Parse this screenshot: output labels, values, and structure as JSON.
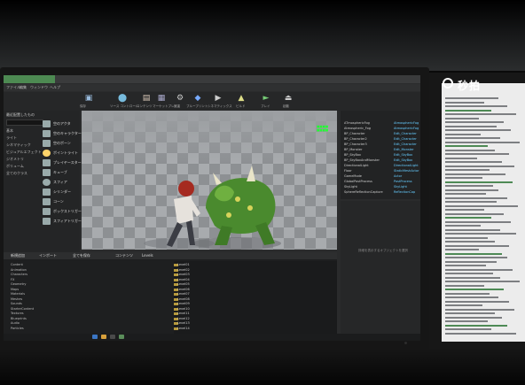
{
  "left_monitor": {
    "titlebar_text": "",
    "menu": [
      "ファイル",
      "編集",
      "ウィンドウ",
      "ヘルプ"
    ],
    "toolbar": [
      {
        "icon": "save-icon",
        "label": "保存"
      },
      {
        "icon": "source-control-icon",
        "label": "ソース コントロール"
      },
      {
        "icon": "content-icon",
        "label": "コンテンツ"
      },
      {
        "icon": "marketplace-icon",
        "label": "マーケットプレイス"
      },
      {
        "icon": "settings-icon",
        "label": "設定"
      },
      {
        "icon": "blueprints-icon",
        "label": "ブループリント"
      },
      {
        "icon": "cinematics-icon",
        "label": "シネマティックス"
      },
      {
        "icon": "build-icon",
        "label": "ビルド"
      },
      {
        "icon": "play-icon",
        "label": "プレイ"
      },
      {
        "icon": "launch-icon",
        "label": "起動"
      }
    ],
    "modes_panel": {
      "title": "最近配置したもの",
      "categories": [
        "基本",
        "ライト",
        "シネマティック",
        "ビジュアルエフェクト",
        "ジオメトリ",
        "ボリューム",
        "全てのクラス"
      ],
      "assets": [
        "空のアクタ",
        "空のキャラクター",
        "空のポーン",
        "ポイントライト",
        "プレイヤースタート",
        "キューブ",
        "スフィア",
        "シリンダー",
        "コーン",
        "ボックストリガー",
        "スフィアトリガー"
      ]
    },
    "outliner": {
      "rows": [
        {
          "label": "ATmosphericFog",
          "type": "AtmosphericFog"
        },
        {
          "label": "Atmospheric_Fog",
          "type": "AtmosphericFog"
        },
        {
          "label": "BP_Character",
          "type": "Edit_Character"
        },
        {
          "label": "BP_Character2",
          "type": "Edit_Character"
        },
        {
          "label": "BP_Character3",
          "type": "Edit_Character"
        },
        {
          "label": "BP_Monster",
          "type": "Edit_Monster"
        },
        {
          "label": "BP_SkyBox",
          "type": "Edit_SkyBox"
        },
        {
          "label": "BP_SkyBoxAndMonster",
          "type": "Edit_SkyBox"
        },
        {
          "label": "DirectionalLight",
          "type": "DirectionalLight"
        },
        {
          "label": "Floor",
          "type": "StaticMeshActor"
        },
        {
          "label": "GameMode",
          "type": "Actor"
        },
        {
          "label": "GlobalPostProcess",
          "type": "PostProcess"
        },
        {
          "label": "SkyLight",
          "type": "SkyLight"
        },
        {
          "label": "SphereReflectionCapture",
          "type": "ReflectionCap"
        }
      ]
    },
    "details_text": "詳細を表示するオブジェクトを選択",
    "content_browser": {
      "buttons": [
        "新規追加",
        "インポート",
        "全てを保存",
        "コンテンツ",
        "Levels"
      ],
      "tree": [
        "Content",
        "Animation",
        "Characters",
        "FX",
        "Geometry",
        "Maps",
        "Materials",
        "Meshes",
        "Sounds",
        "StarterContent",
        "Textures",
        "Blueprints",
        "Audio",
        "Particles"
      ],
      "items": [
        "Level01",
        "Level02",
        "Level03",
        "Level04",
        "Level05",
        "Level06",
        "Level07",
        "Level08",
        "Level09",
        "Level10",
        "Level11",
        "Level12",
        "Level13",
        "Level14"
      ]
    },
    "taskbar_time": ""
  },
  "right_monitor": {
    "watermark": "秒拍"
  },
  "colors": {
    "ue_accent": "#4d8a52",
    "log_green": "#2f3",
    "type_blue": "#6cf"
  }
}
